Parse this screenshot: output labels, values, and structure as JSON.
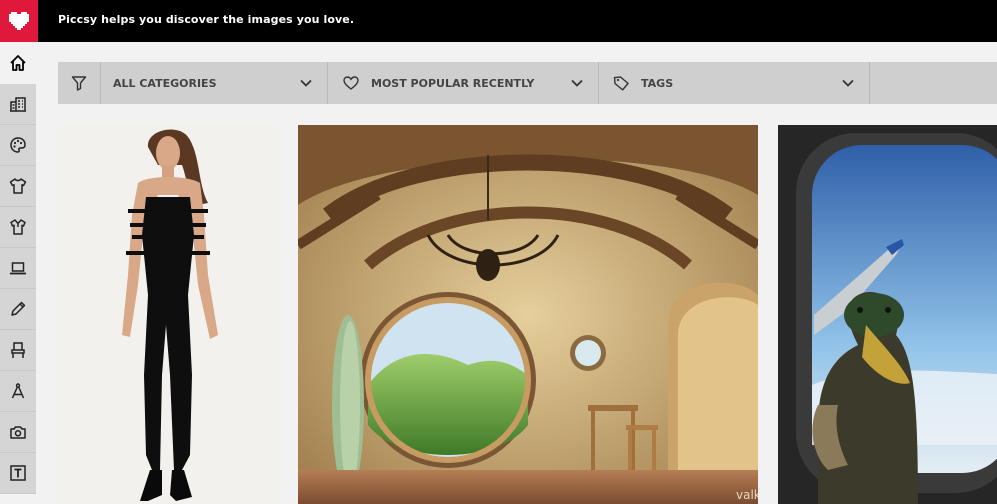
{
  "app": {
    "tagline": "Piccsy helps you discover the images you love.",
    "brand_color": "#e0193c"
  },
  "sidebar": {
    "items": [
      {
        "icon": "home-icon"
      },
      {
        "icon": "city-icon"
      },
      {
        "icon": "palette-icon"
      },
      {
        "icon": "mens-shirt-icon"
      },
      {
        "icon": "womens-shirt-icon"
      },
      {
        "icon": "laptop-icon"
      },
      {
        "icon": "pencil-icon"
      },
      {
        "icon": "chair-icon"
      },
      {
        "icon": "compass-icon"
      },
      {
        "icon": "camera-icon"
      },
      {
        "icon": "typography-icon"
      }
    ]
  },
  "filters": {
    "category": {
      "label": "ALL CATEGORIES",
      "icon": "funnel-icon"
    },
    "sort": {
      "label": "MOST POPULAR RECENTLY",
      "icon": "heart-icon"
    },
    "tags": {
      "label": "TAGS",
      "icon": "tag-icon"
    }
  },
  "images": [
    {
      "subject": "woman-in-black-jumpsuit"
    },
    {
      "subject": "hobbit-hole-interior",
      "watermark": "valk"
    },
    {
      "subject": "duck-at-airplane-window"
    }
  ]
}
